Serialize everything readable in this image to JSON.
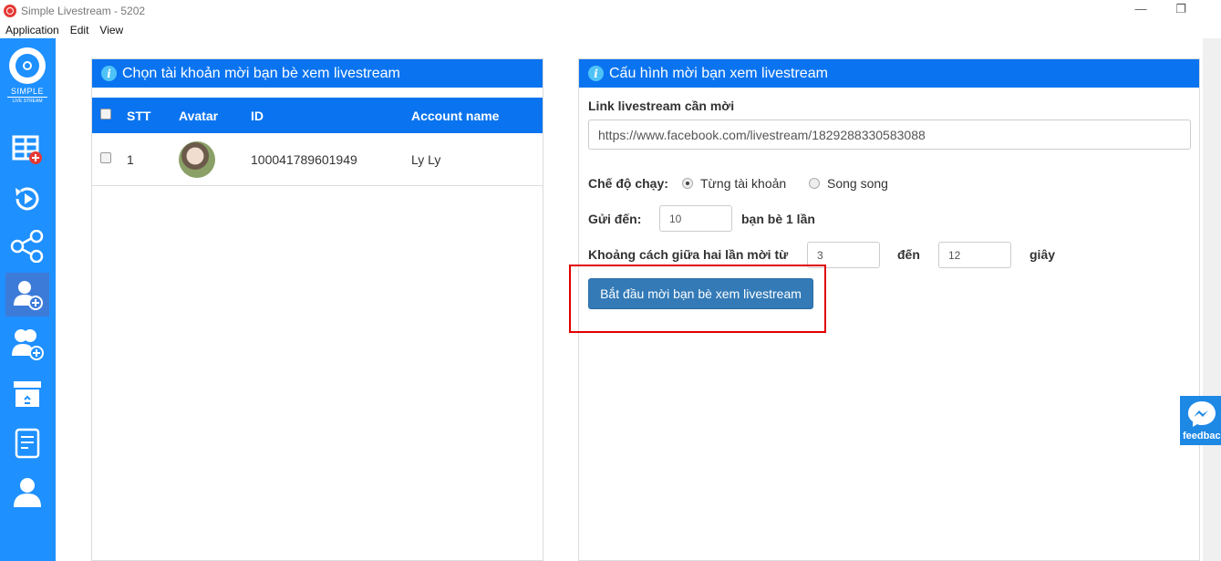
{
  "window": {
    "title": "Simple Livestream - 5202",
    "minimize": "—",
    "restore": "❐"
  },
  "menu": [
    "Application",
    "Edit",
    "View"
  ],
  "logo": {
    "line1": "SIMPLE",
    "line2": "LIVE STREAM"
  },
  "sidebar": [
    {
      "icon": "grid-add-icon"
    },
    {
      "icon": "replay-icon"
    },
    {
      "icon": "share-icon"
    },
    {
      "icon": "add-user-icon",
      "active": true
    },
    {
      "icon": "add-group-icon"
    },
    {
      "icon": "box-icon"
    },
    {
      "icon": "document-icon"
    },
    {
      "icon": "user-icon"
    }
  ],
  "left_panel": {
    "title": "Chọn tài khoản mời bạn bè xem livestream",
    "columns": [
      "STT",
      "Avatar",
      "ID",
      "Account name"
    ],
    "rows": [
      {
        "stt": "1",
        "id": "100041789601949",
        "name": "Ly Ly"
      }
    ]
  },
  "right_panel": {
    "title": "Cấu hình mời bạn xem livestream",
    "link_label": "Link livestream cần mời",
    "link_value": "https://www.facebook.com/livestream/1829288330583088",
    "mode_label": "Chế độ chạy:",
    "mode_options": [
      "Từng tài khoản",
      "Song song"
    ],
    "mode_selected": "Từng tài khoản",
    "send_label": "Gửi đến:",
    "send_value": "10",
    "send_suffix": "bạn bè 1 lần",
    "interval_label": "Khoảng cách giữa hai lần mời từ",
    "interval_from": "3",
    "interval_to_label": "đến",
    "interval_to": "12",
    "interval_unit": "giây",
    "start_button": "Bắt đầu mời bạn bè xem livestream"
  },
  "feedback": {
    "label": "feedback"
  },
  "colors": {
    "sidebar": "#1e90ff",
    "header": "#0a74f0",
    "button": "#337ab7",
    "highlight": "#e00000"
  }
}
